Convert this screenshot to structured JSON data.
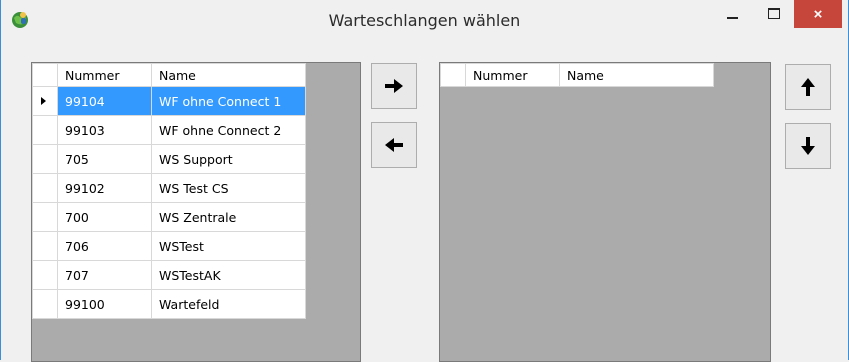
{
  "window": {
    "title": "Warteschlangen wählen",
    "close_glyph": "×"
  },
  "icons": {
    "app": "globe-person-icon",
    "move_right": "arrow-right-icon",
    "move_left": "arrow-left-icon",
    "move_up": "arrow-up-icon",
    "move_down": "arrow-down-icon"
  },
  "available": {
    "columns": [
      "Nummer",
      "Name"
    ],
    "rows": [
      {
        "nummer": "99104",
        "name": "WF ohne Connect 1",
        "selected": true
      },
      {
        "nummer": "99103",
        "name": "WF ohne Connect 2",
        "selected": false
      },
      {
        "nummer": "705",
        "name": "WS Support",
        "selected": false
      },
      {
        "nummer": "99102",
        "name": "WS Test CS",
        "selected": false
      },
      {
        "nummer": "700",
        "name": "WS Zentrale",
        "selected": false
      },
      {
        "nummer": "706",
        "name": "WSTest",
        "selected": false
      },
      {
        "nummer": "707",
        "name": "WSTestAK",
        "selected": false
      },
      {
        "nummer": "99100",
        "name": "Wartefeld",
        "selected": false
      }
    ]
  },
  "chosen": {
    "columns": [
      "Nummer",
      "Name"
    ],
    "rows": []
  },
  "colors": {
    "selection": "#3399ff",
    "close_button": "#c7463b",
    "grid_background": "#ababab"
  }
}
